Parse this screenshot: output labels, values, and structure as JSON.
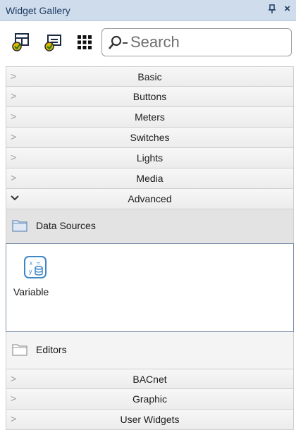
{
  "panel": {
    "title": "Widget Gallery",
    "pin_glyph": "ᵖ",
    "close_glyph": "×"
  },
  "toolbar": {
    "buttons": [
      {
        "icon": "add-widget-icon"
      },
      {
        "icon": "edit-widget-icon"
      },
      {
        "icon": "grid-view-icon"
      }
    ],
    "search_placeholder": "Search"
  },
  "categories_top": [
    {
      "label": "Basic"
    },
    {
      "label": "Buttons"
    },
    {
      "label": "Meters"
    },
    {
      "label": "Switches"
    },
    {
      "label": "Lights"
    },
    {
      "label": "Media"
    }
  ],
  "expanded": {
    "label": "Advanced",
    "groups": [
      {
        "label": "Data Sources",
        "items": [
          {
            "label": "Variable",
            "icon": "variable-icon"
          }
        ]
      },
      {
        "label": "Editors"
      }
    ]
  },
  "categories_bottom": [
    {
      "label": "BACnet"
    },
    {
      "label": "Graphic"
    },
    {
      "label": "User Widgets"
    }
  ],
  "chevron_collapsed": ">",
  "chevron_expanded": "⌄"
}
